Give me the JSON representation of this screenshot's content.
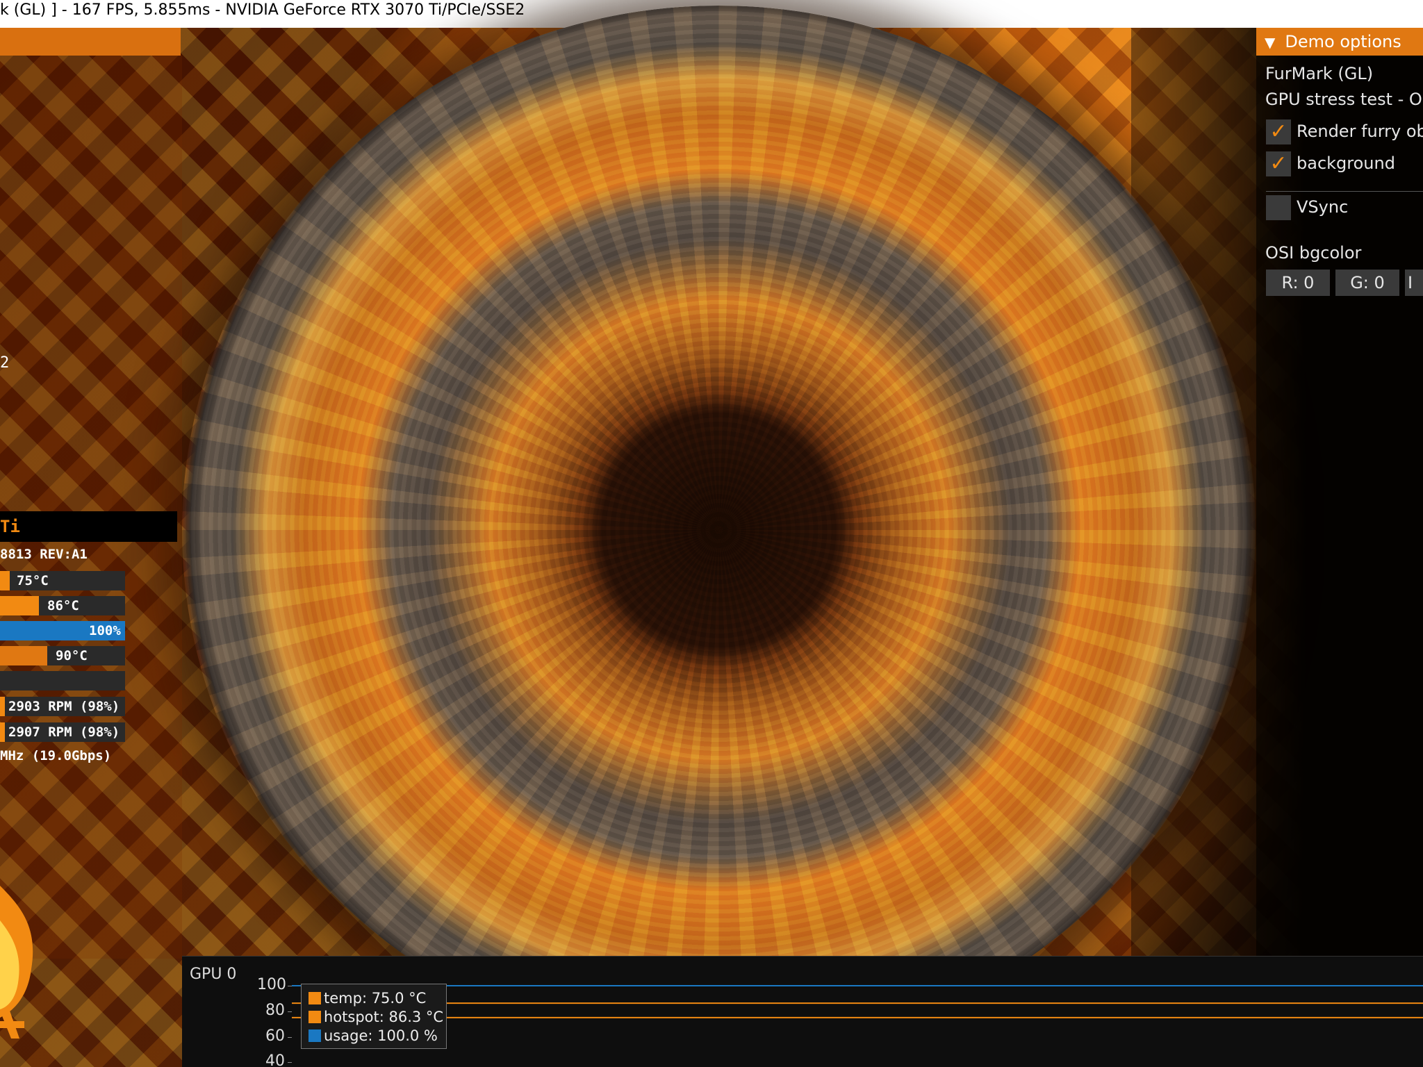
{
  "window": {
    "title": "k (GL) ] - 167 FPS, 5.855ms - NVIDIA GeForce RTX 3070 Ti/PCIe/SSE2"
  },
  "osi": {
    "fragment_2": "2",
    "gpu_name_fragment": "Ti",
    "device_line": "8813 REV:A1",
    "bars": [
      {
        "label": "75°C",
        "fill_pct": 8,
        "color": "#f28a12"
      },
      {
        "label": "86°C",
        "fill_pct": 31,
        "color": "#f28a12"
      },
      {
        "label": "100%",
        "fill_pct": 100,
        "color": "#1a78c2"
      },
      {
        "label": "90°C",
        "fill_pct": 38,
        "color": "#e07812"
      },
      {
        "label": "",
        "fill_pct": 0,
        "color": "#f28a12"
      },
      {
        "label": "2903 RPM (98%)",
        "fill_pct": 4,
        "color": "#f28a12"
      },
      {
        "label": "2907 RPM (98%)",
        "fill_pct": 4,
        "color": "#f28a12"
      }
    ],
    "memory_line": "MHz (19.0Gbps)"
  },
  "demo_options": {
    "header": "Demo options",
    "line1": "FurMark (GL)",
    "line2": "GPU stress test - Op",
    "render_furry_label": "Render furry obj",
    "background_label": "background",
    "vsync_label": "VSync",
    "osi_bgcolor_label": "OSI bgcolor",
    "r_label": "R: 0",
    "g_label": "G: 0",
    "b_label": "I",
    "render_furry_checked": true,
    "background_checked": true,
    "vsync_checked": false,
    "check_glyph": "✓"
  },
  "graph": {
    "title": "GPU 0",
    "yticks": [
      "100",
      "80",
      "60",
      "40"
    ],
    "legend": [
      {
        "label": "temp: 75.0 °C",
        "color": "#f28a12"
      },
      {
        "label": "hotspot: 86.3 °C",
        "color": "#f28a12"
      },
      {
        "label": "usage: 100.0 %",
        "color": "#1a78c2"
      }
    ],
    "series": [
      {
        "name": "temp",
        "value": 75.0,
        "color": "#f28a12"
      },
      {
        "name": "hotspot",
        "value": 86.3,
        "color": "#f28a12"
      },
      {
        "name": "usage",
        "value": 100.0,
        "color": "#1a78c2"
      }
    ]
  },
  "icons": {
    "collapse": "triangle-down-icon",
    "logo": "flame-logo-icon"
  }
}
